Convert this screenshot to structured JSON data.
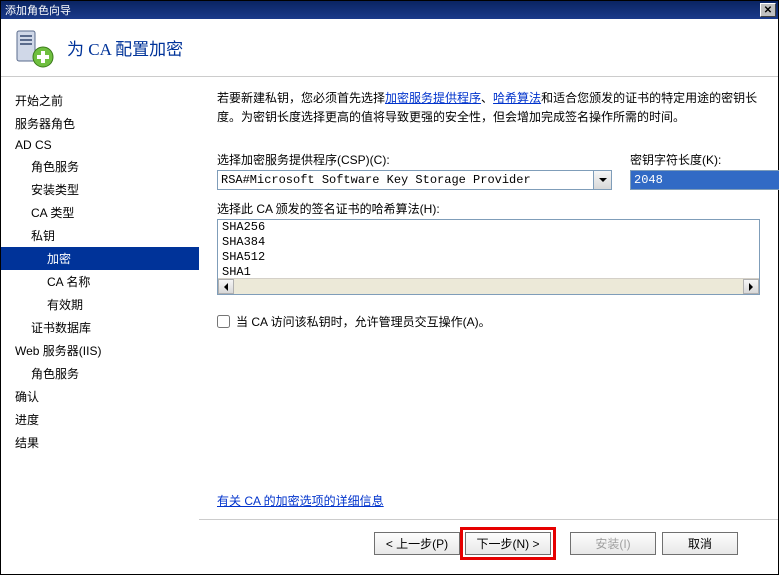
{
  "window": {
    "title": "添加角色向导"
  },
  "header": {
    "title": "为 CA 配置加密"
  },
  "sidebar": {
    "items": [
      {
        "label": "开始之前",
        "indent": 0
      },
      {
        "label": "服务器角色",
        "indent": 0
      },
      {
        "label": "AD CS",
        "indent": 0
      },
      {
        "label": "角色服务",
        "indent": 1
      },
      {
        "label": "安装类型",
        "indent": 1
      },
      {
        "label": "CA 类型",
        "indent": 1
      },
      {
        "label": "私钥",
        "indent": 1
      },
      {
        "label": "加密",
        "indent": 2,
        "active": true
      },
      {
        "label": "CA 名称",
        "indent": 2
      },
      {
        "label": "有效期",
        "indent": 2
      },
      {
        "label": "证书数据库",
        "indent": 1
      },
      {
        "label": "Web 服务器(IIS)",
        "indent": 0
      },
      {
        "label": "角色服务",
        "indent": 1
      },
      {
        "label": "确认",
        "indent": 0
      },
      {
        "label": "进度",
        "indent": 0
      },
      {
        "label": "结果",
        "indent": 0
      }
    ]
  },
  "content": {
    "intro_pre": "若要新建私钥，您必须首先选择",
    "intro_link1": "加密服务提供程序",
    "intro_sep1": "、",
    "intro_link2": "哈希算法",
    "intro_post": "和适合您颁发的证书的特定用途的密钥长度。为密钥长度选择更高的值将导致更强的安全性，但会增加完成签名操作所需的时间。",
    "csp_label": "选择加密服务提供程序(CSP)(C):",
    "csp_value": "RSA#Microsoft Software Key Storage Provider",
    "keylen_label": "密钥字符长度(K):",
    "keylen_value": "2048",
    "hash_label": "选择此 CA 颁发的签名证书的哈希算法(H):",
    "hash_options": [
      "SHA256",
      "SHA384",
      "SHA512",
      "SHA1"
    ],
    "checkbox_label": "当 CA 访问该私钥时，允许管理员交互操作(A)。",
    "help_link": "有关 CA 的加密选项的详细信息"
  },
  "footer": {
    "prev": "< 上一步(P)",
    "next": "下一步(N) >",
    "install": "安装(I)",
    "cancel": "取消"
  }
}
